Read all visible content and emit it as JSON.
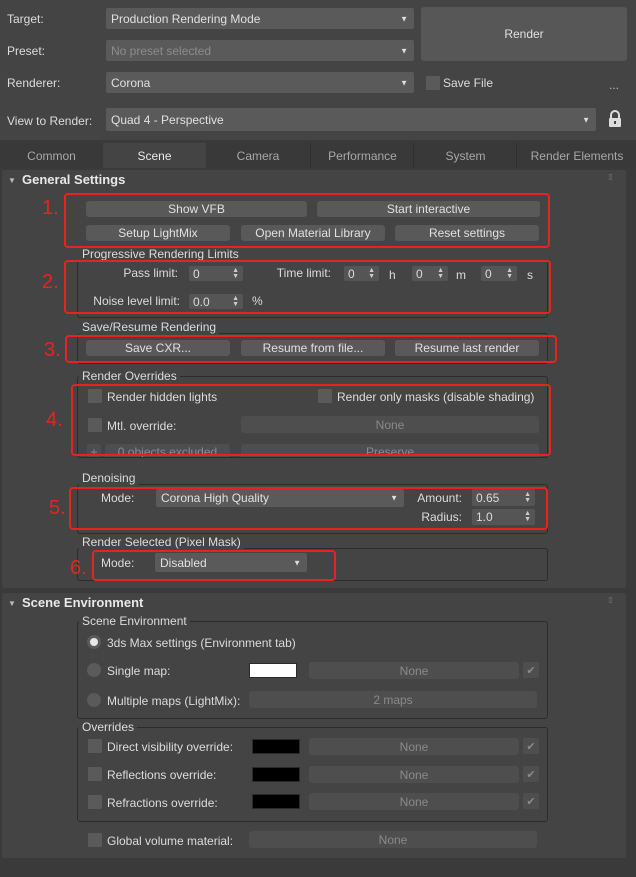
{
  "header": {
    "target_label": "Target:",
    "target_value": "Production Rendering Mode",
    "preset_label": "Preset:",
    "preset_value": "No preset selected",
    "renderer_label": "Renderer:",
    "renderer_value": "Corona",
    "view_label": "View to Render:",
    "view_value": "Quad 4 - Perspective",
    "render_button": "Render",
    "save_file_label": "Save File",
    "save_file_checked": false,
    "more_button": "...",
    "lock_icon": "lock-icon"
  },
  "tabs": [
    {
      "label": "Common",
      "active": false
    },
    {
      "label": "Scene",
      "active": true
    },
    {
      "label": "Camera",
      "active": false
    },
    {
      "label": "Performance",
      "active": false
    },
    {
      "label": "System",
      "active": false
    },
    {
      "label": "Render Elements",
      "active": false
    }
  ],
  "annotations": {
    "color": "#e8231f",
    "labels": [
      "1.",
      "2.",
      "3.",
      "4.",
      "5.",
      "6."
    ]
  },
  "general": {
    "title": "General Settings",
    "buttons": [
      "Show VFB",
      "Start interactive",
      "Setup LightMix",
      "Open Material Library",
      "Reset settings"
    ],
    "progressive": {
      "title": "Progressive Rendering Limits",
      "pass_label": "Pass limit:",
      "pass_value": "0",
      "time_label": "Time limit:",
      "hours": "0",
      "h": "h",
      "minutes": "0",
      "m": "m",
      "seconds": "0",
      "s": "s",
      "noise_label": "Noise level limit:",
      "noise_value": "0.0",
      "noise_unit": "%"
    },
    "save_resume": {
      "title": "Save/Resume Rendering",
      "buttons": [
        "Save CXR...",
        "Resume from file...",
        "Resume last render"
      ]
    },
    "overrides": {
      "title": "Render Overrides",
      "hidden_lights": "Render hidden lights",
      "only_masks": "Render only masks (disable shading)",
      "mtl_override": "Mtl. override:",
      "mtl_value": "None",
      "plus": "+",
      "excluded": "0 objects excluded",
      "preserve": "Preserve"
    },
    "denoising": {
      "title": "Denoising",
      "mode_label": "Mode:",
      "mode_value": "Corona High Quality",
      "amount_label": "Amount:",
      "amount_value": "0.65",
      "radius_label": "Radius:",
      "radius_value": "1.0"
    },
    "render_selected": {
      "title": "Render Selected (Pixel Mask)",
      "mode_label": "Mode:",
      "mode_value": "Disabled"
    }
  },
  "scene_env": {
    "title": "Scene Environment",
    "group_title": "Scene Environment",
    "opt_max": "3ds Max settings (Environment tab)",
    "opt_single": "Single map:",
    "single_color": "#ffffff",
    "single_map": "None",
    "opt_multi": "Multiple maps (LightMix):",
    "multi_value": "2 maps",
    "selected_option": "3ds Max settings (Environment tab)",
    "overrides_title": "Overrides",
    "overrides": [
      {
        "label": "Direct visibility override:",
        "color": "#000000",
        "map": "None"
      },
      {
        "label": "Reflections override:",
        "color": "#000000",
        "map": "None"
      },
      {
        "label": "Refractions override:",
        "color": "#000000",
        "map": "None"
      }
    ],
    "global_volume_label": "Global volume material:",
    "global_volume_value": "None",
    "check_glyph": "✔"
  }
}
